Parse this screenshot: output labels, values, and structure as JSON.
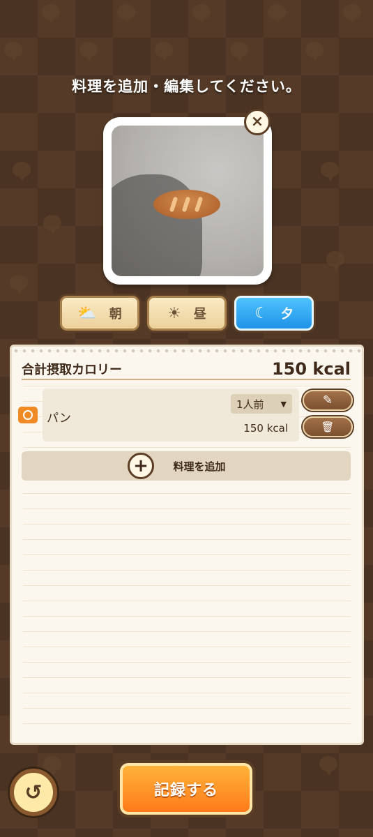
{
  "header": {
    "instruction": "料理を追加・編集してください。"
  },
  "photo": {
    "close_icon": "×"
  },
  "meal_tabs": [
    {
      "label": "朝",
      "icon": "sunrise-icon",
      "glyph": "⛅",
      "active": false
    },
    {
      "label": "昼",
      "icon": "sun-icon",
      "glyph": "☀",
      "active": false
    },
    {
      "label": "夕",
      "icon": "moon-icon",
      "glyph": "☾",
      "active": true
    }
  ],
  "panel": {
    "total_label": "合計摂取カロリー",
    "total_value": "150 kcal",
    "item": {
      "name": "パン",
      "portion": "1人前",
      "portion_caret": "▼",
      "kcal": "150 kcal",
      "edit_glyph": "✎",
      "delete_glyph": "🗑"
    },
    "add_label": "料理を追加",
    "add_plus": "+"
  },
  "footer": {
    "back_glyph": "↺",
    "record_label": "記録する"
  },
  "colors": {
    "background": "#4a3322",
    "active_tab": "#2ea4f2",
    "record_button": "#ff8c22"
  }
}
